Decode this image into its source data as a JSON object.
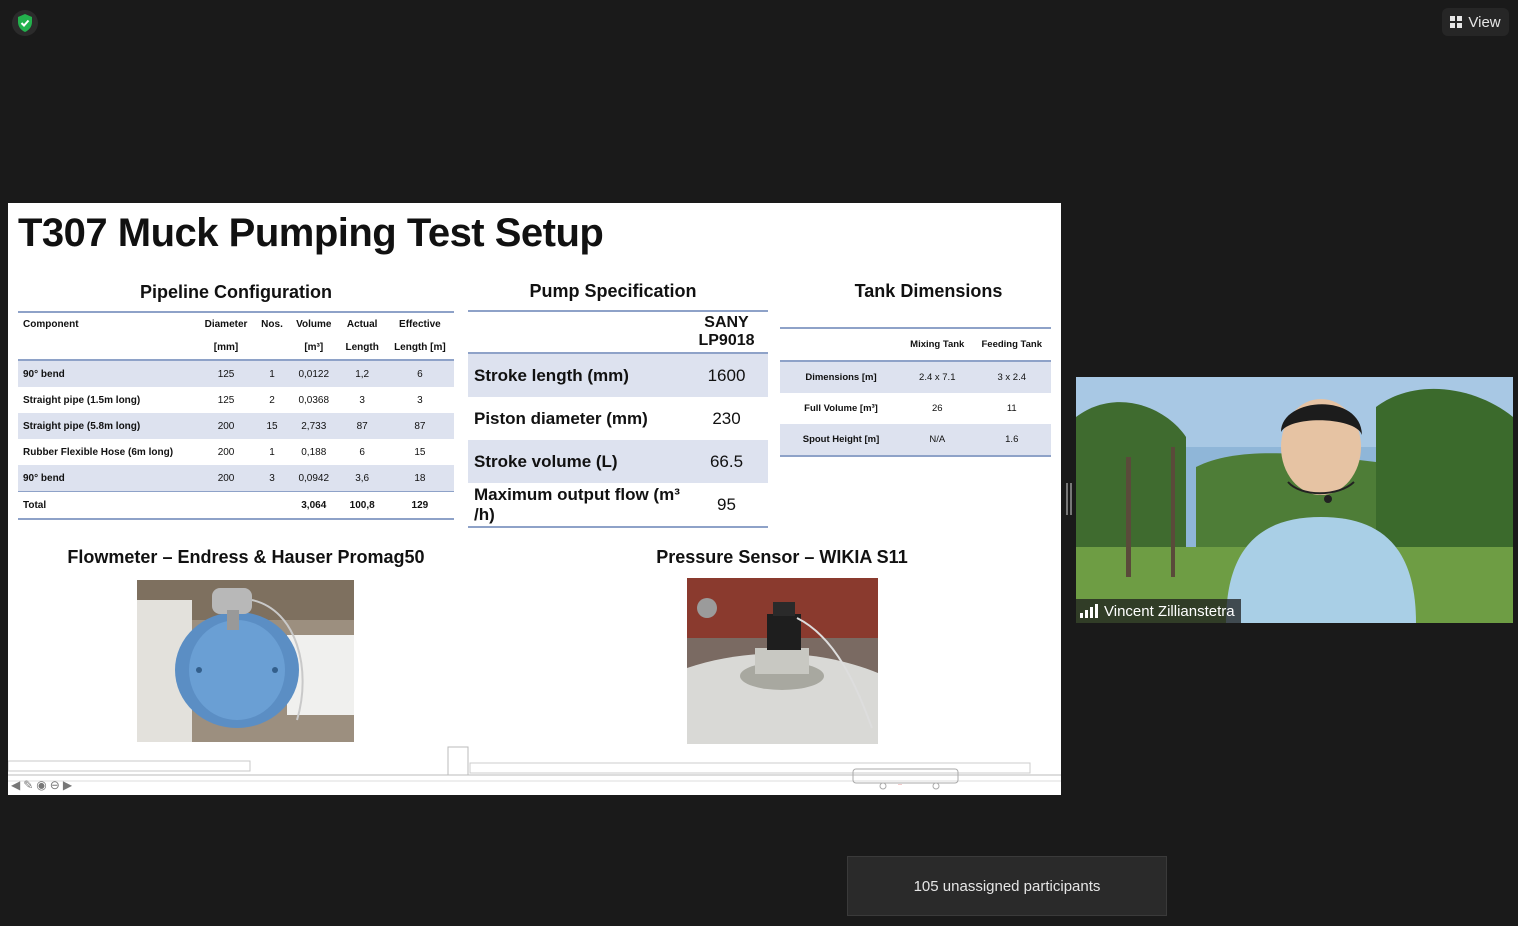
{
  "toolbar": {
    "view_label": "View"
  },
  "slide": {
    "title": "T307 Muck Pumping Test Setup",
    "pipeline": {
      "title": "Pipeline Configuration",
      "header_row1": [
        "Component",
        "Diameter",
        "Nos.",
        "Volume",
        "Actual",
        "Effective"
      ],
      "header_row2": [
        "",
        "[mm]",
        "",
        "[m³]",
        "Length",
        "Length [m]"
      ],
      "rows": [
        [
          "90° bend",
          "125",
          "1",
          "0,0122",
          "1,2",
          "6"
        ],
        [
          "Straight pipe (1.5m long)",
          "125",
          "2",
          "0,0368",
          "3",
          "3"
        ],
        [
          "Straight pipe (5.8m long)",
          "200",
          "15",
          "2,733",
          "87",
          "87"
        ],
        [
          "Rubber Flexible Hose (6m long)",
          "200",
          "1",
          "0,188",
          "6",
          "15"
        ],
        [
          "90° bend",
          "200",
          "3",
          "0,0942",
          "3,6",
          "18"
        ]
      ],
      "total": [
        "Total",
        "",
        "",
        "3,064",
        "100,8",
        "129"
      ]
    },
    "pump": {
      "title": "Pump Specification",
      "model": "SANY LP9018",
      "rows": [
        [
          "Stroke length (mm)",
          "1600"
        ],
        [
          "Piston diameter (mm)",
          "230"
        ],
        [
          "Stroke volume (L)",
          "66.5"
        ],
        [
          "Maximum output flow (m³ /h)",
          "95"
        ]
      ]
    },
    "tank": {
      "title": "Tank Dimensions",
      "headers": [
        "",
        "Mixing Tank",
        "Feeding Tank"
      ],
      "rows": [
        [
          "Dimensions [m]",
          "2.4 x 7.1",
          "3 x 2.4"
        ],
        [
          "Full Volume [m³]",
          "26",
          "11"
        ],
        [
          "Spout Height [m]",
          "N/A",
          "1.6"
        ]
      ]
    },
    "flowmeter_title": "Flowmeter – Endress & Hauser Promag50",
    "pressure_title": "Pressure Sensor – WIKIA S11"
  },
  "video": {
    "participant_name": "Vincent Zillianstetra"
  },
  "banner": {
    "unassigned_text": "105 unassigned participants"
  },
  "colors": {
    "shade": "#dde2ef",
    "rule": "#8ea2c8",
    "security_green": "#23b14d"
  }
}
